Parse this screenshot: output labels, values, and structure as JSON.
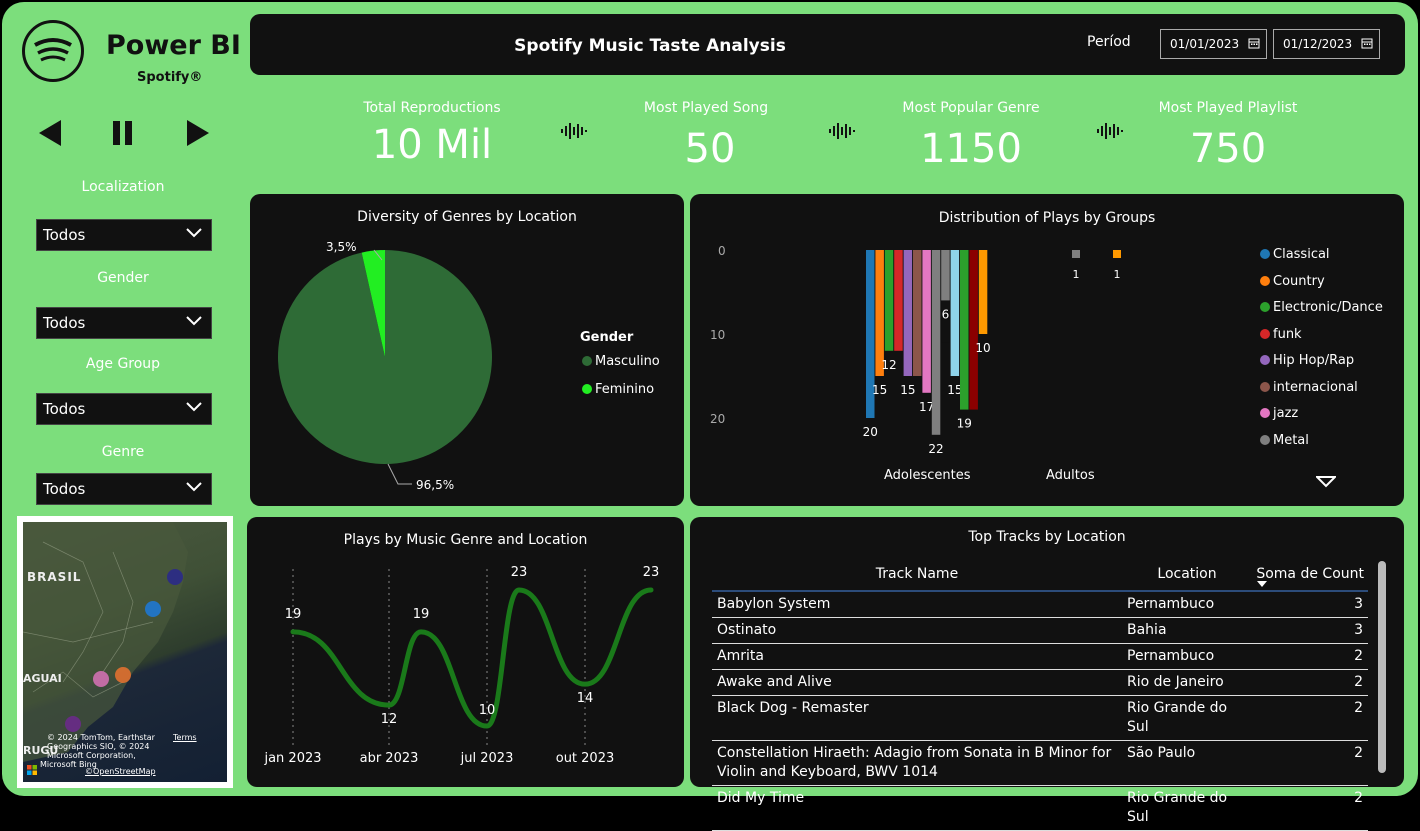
{
  "brand": {
    "title": "Power BI",
    "subtitle": "Spotify®"
  },
  "player": {
    "prev_icon": "skip-back-icon",
    "pause_icon": "pause-icon",
    "next_icon": "skip-forward-icon"
  },
  "slicers": [
    {
      "label": "Localization",
      "value": "Todos"
    },
    {
      "label": "Gender",
      "value": "Todos"
    },
    {
      "label": "Age Group",
      "value": "Todos"
    },
    {
      "label": "Genre",
      "value": "Todos"
    }
  ],
  "map": {
    "country_label": "BRASIL",
    "neighbor_label_1": "AGUAI",
    "neighbor_label_2": "RUGU",
    "attribution_1": "© 2024 TomTom, Earthstar",
    "attribution_2": "Geographics SIO, © 2024",
    "attribution_3": "Microsoft Corporation,",
    "attribution_4": "©OpenStreetMap",
    "terms": "Terms",
    "ms_bing": "Microsoft Bing",
    "point_colors": [
      "#2a2a8a",
      "#1f78d1",
      "#d070b0",
      "#e07030",
      "#6a2a8a"
    ]
  },
  "header": {
    "title": "Spotify Music Taste Analysis",
    "period_label": "Períod",
    "date_start": "01/01/2023",
    "date_end": "01/12/2023"
  },
  "kpis": [
    {
      "label": "Total Reproductions",
      "value": "10 Mil"
    },
    {
      "label": "Most Played Song",
      "value": "50"
    },
    {
      "label": "Most Popular Genre",
      "value": "1150"
    },
    {
      "label": "Most Played Playlist",
      "value": "750"
    }
  ],
  "pie": {
    "title": "Diversity of Genres by Location",
    "legend_title": "Gender",
    "label_small": "3,5%",
    "label_large": "96,5%"
  },
  "bars": {
    "title": "Distribution of Plays by Groups",
    "groups": [
      "Adolescentes",
      "Adultos"
    ],
    "legend_more_icon": "triangle-down-icon"
  },
  "line": {
    "title": "Plays by Music Genre and Location"
  },
  "table": {
    "title": "Top Tracks by Location",
    "columns": [
      "Track Name",
      "Location",
      "Soma de Count"
    ],
    "rows": [
      [
        "Babylon System",
        "Pernambuco",
        "3"
      ],
      [
        "Ostinato",
        "Bahia",
        "3"
      ],
      [
        "Amrita",
        "Pernambuco",
        "2"
      ],
      [
        "Awake and Alive",
        "Rio de Janeiro",
        "2"
      ],
      [
        "Black Dog - Remaster",
        "Rio Grande do Sul",
        "2"
      ],
      [
        "Constellation Hiraeth: Adagio from Sonata in B Minor for Violin and Keyboard, BWV 1014",
        "São Paulo",
        "2"
      ],
      [
        "Did My Time",
        "Rio Grande do Sul",
        "2"
      ]
    ]
  },
  "chart_data": [
    {
      "type": "pie",
      "title": "Diversity of Genres by Location",
      "legend_title": "Gender",
      "slices": [
        {
          "name": "Masculino",
          "value": 96.5,
          "label": "96,5%",
          "color": "#2e6b36"
        },
        {
          "name": "Feminino",
          "value": 3.5,
          "label": "3,5%",
          "color": "#22ee22"
        }
      ],
      "legend_position": "right"
    },
    {
      "type": "bar",
      "title": "Distribution of Plays by Groups",
      "categories": [
        "Adolescentes",
        "Adultos"
      ],
      "yticks": [
        "0",
        "10",
        "20"
      ],
      "ylim": [
        0,
        24
      ],
      "y_inverted": true,
      "legend_position": "right",
      "series": [
        {
          "name": "Classical",
          "color": "#1f77b4",
          "values": [
            20,
            null
          ],
          "label": "20"
        },
        {
          "name": "Country",
          "color": "#ff7f0e",
          "values": [
            15,
            1
          ],
          "label": "15"
        },
        {
          "name": "Electronic/Dance",
          "color": "#2ca02c",
          "values": [
            12,
            null
          ],
          "label": "12"
        },
        {
          "name": "funk",
          "color": "#d62728",
          "values": [
            12,
            null
          ],
          "label": ""
        },
        {
          "name": "Hip Hop/Rap",
          "color": "#9467bd",
          "values": [
            15,
            null
          ],
          "label": "15"
        },
        {
          "name": "internacional",
          "color": "#8c564b",
          "values": [
            15,
            null
          ],
          "label": ""
        },
        {
          "name": "jazz",
          "color": "#e377c2",
          "values": [
            17,
            null
          ],
          "label": "17"
        },
        {
          "name": "Metal",
          "color": "#7f7f7f",
          "values": [
            22,
            1
          ],
          "label": "22"
        },
        {
          "name": "",
          "color": "#111111",
          "values": [
            6,
            null
          ],
          "label": "6"
        },
        {
          "name": "",
          "color": "#8fd3ea",
          "values": [
            15,
            null
          ],
          "label": "15"
        },
        {
          "name": "",
          "color": "#2ca02c",
          "values": [
            19,
            null
          ],
          "label": "19"
        },
        {
          "name": "",
          "color": "#8b0000",
          "values": [
            19,
            null
          ],
          "label": ""
        },
        {
          "name": "",
          "color": "#ff9900",
          "values": [
            10,
            null
          ],
          "label": "10"
        }
      ],
      "adultos_labels": [
        "1",
        "1"
      ]
    },
    {
      "type": "line",
      "title": "Plays by Music Genre and Location",
      "xlabels": [
        "jan 2023",
        "abr 2023",
        "jul 2023",
        "out 2023"
      ],
      "points": [
        19,
        12,
        19,
        10,
        23,
        14,
        23
      ],
      "ylim": [
        8,
        25
      ],
      "color": "#1a7a1a"
    }
  ]
}
